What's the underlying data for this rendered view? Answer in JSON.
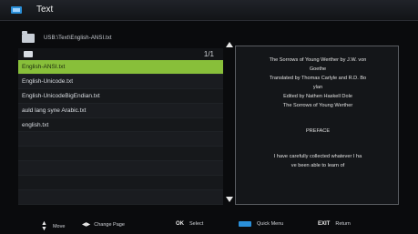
{
  "titlebar": {
    "title": "Text"
  },
  "path": "USB:\\Text\\English-ANSI.txt",
  "list": {
    "count": "1/1",
    "items": [
      {
        "label": "English-ANSI.txt",
        "selected": true
      },
      {
        "label": "English-Unicode.txt",
        "selected": false
      },
      {
        "label": "English-UnicodeBigEndian.txt",
        "selected": false
      },
      {
        "label": "auld lang syne Arabic.txt",
        "selected": false
      },
      {
        "label": "english.txt",
        "selected": false
      },
      {
        "label": "",
        "selected": false
      },
      {
        "label": "",
        "selected": false
      },
      {
        "label": "",
        "selected": false
      },
      {
        "label": "",
        "selected": false
      },
      {
        "label": "",
        "selected": false
      }
    ]
  },
  "preview": {
    "lines": [
      "The Sorrows of Young Werther by J.W. von",
      "Goethe",
      "Translated by Thomas Carlyle and R.D. Bo",
      "ylan",
      "Edited by Nathen Haskell Dole",
      "The Sorrows of Young Werther",
      "",
      "PREFACE",
      "",
      "I have carefully collected whatever I ha",
      "ve been able to learn of"
    ]
  },
  "footer": {
    "move": "Move",
    "change_page_key": "◀▶",
    "change_page": "Change Page",
    "ok_key": "OK",
    "select": "Select",
    "quick_menu": "Quick Menu",
    "exit_key": "EXIT",
    "return": "Return"
  },
  "colors": {
    "accent": "#88bf3a",
    "brand_blue": "#2a8fd8"
  }
}
